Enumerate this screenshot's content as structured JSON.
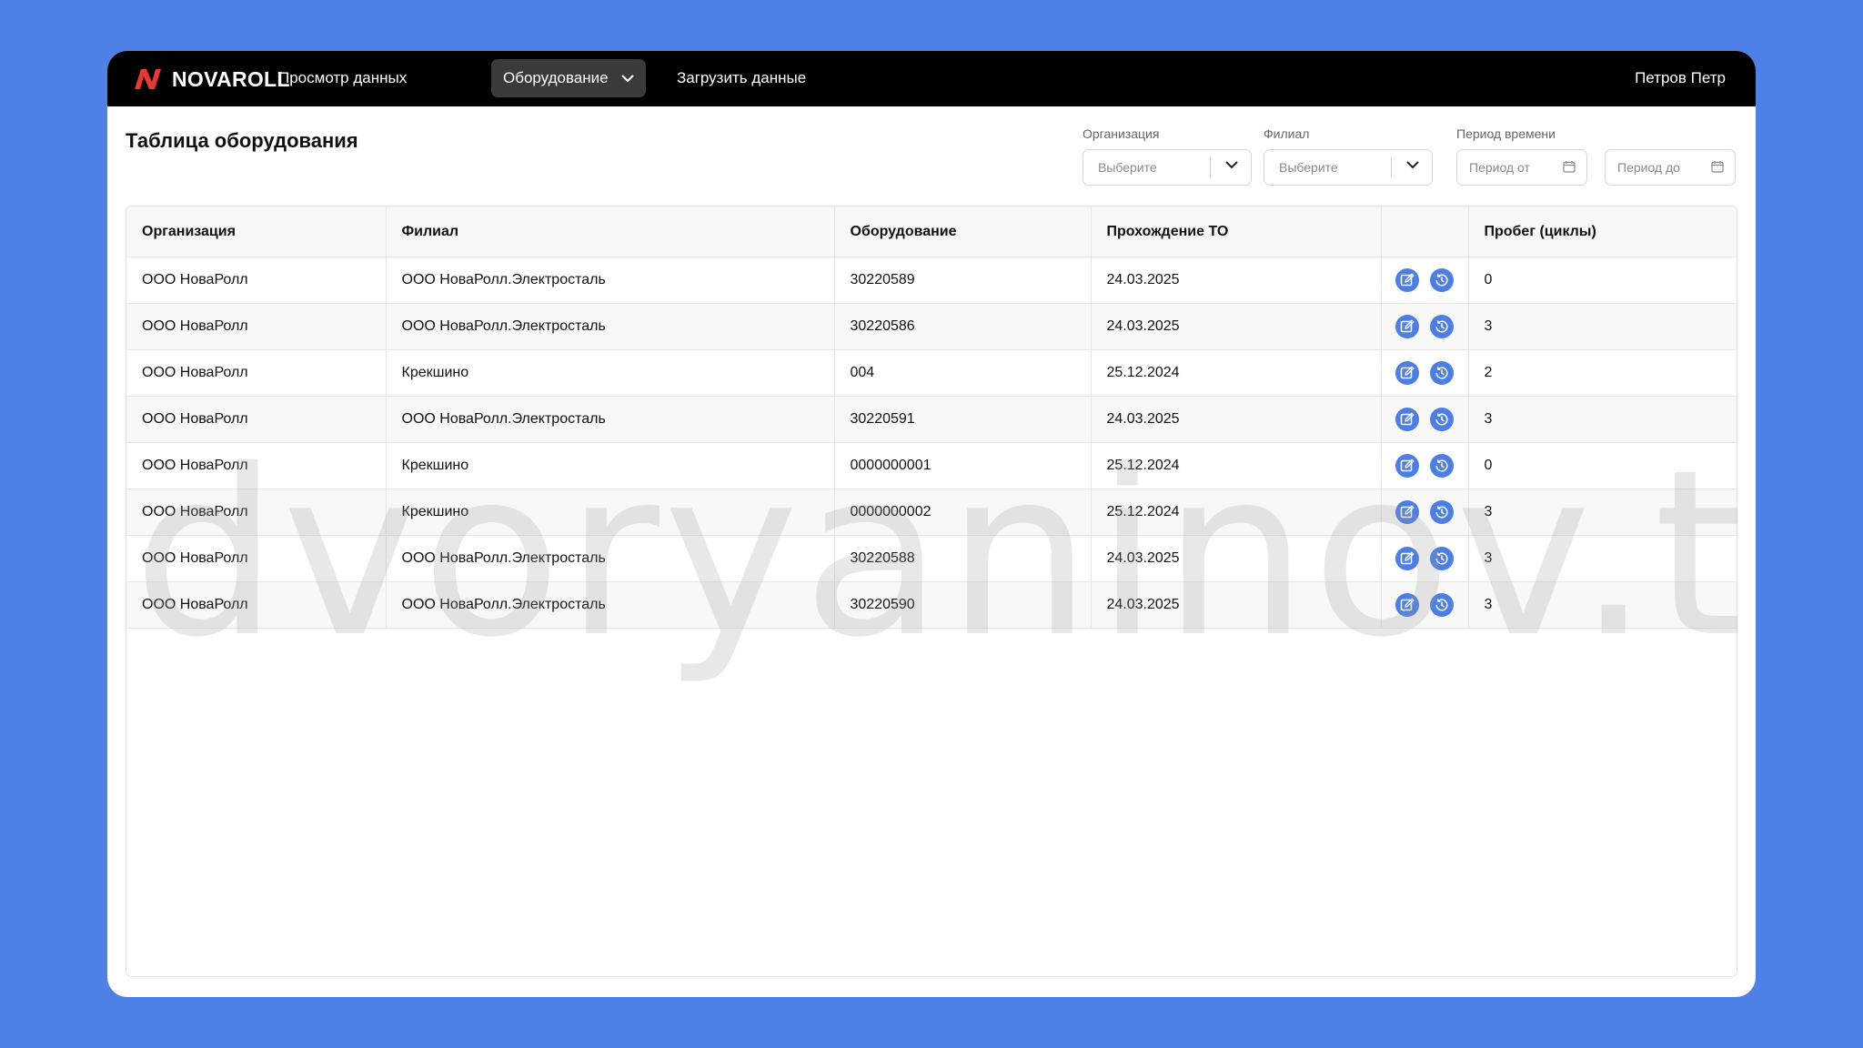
{
  "brand": {
    "name": "NOVAROLL",
    "logo_color": "#e53935"
  },
  "nav": {
    "items": [
      {
        "label": "Просмотр данных"
      },
      {
        "label": "Оборудование"
      },
      {
        "label": "Загрузить данные"
      }
    ],
    "active_index": 1,
    "user_name": "Петров Петр"
  },
  "page": {
    "title": "Таблица оборудования"
  },
  "filters": {
    "organization": {
      "label": "Организация",
      "placeholder": "Выберите"
    },
    "branch": {
      "label": "Филиал",
      "placeholder": "Выберите"
    },
    "period": {
      "label": "Период времени",
      "from_placeholder": "Период от",
      "to_placeholder": "Период до"
    }
  },
  "table": {
    "columns": [
      "Организация",
      "Филиал",
      "Оборудование",
      "Прохождение ТО",
      "",
      "Пробег (циклы)"
    ],
    "rows": [
      [
        "ООО НоваРолл",
        "ООО НоваРолл.Электросталь",
        "30220589",
        "24.03.2025",
        "0"
      ],
      [
        "ООО НоваРолл",
        "ООО НоваРолл.Электросталь",
        "30220586",
        "24.03.2025",
        "3"
      ],
      [
        "ООО НоваРолл",
        "Крекшино",
        "004",
        "25.12.2024",
        "2"
      ],
      [
        "ООО НоваРолл",
        "ООО НоваРолл.Электросталь",
        "30220591",
        "24.03.2025",
        "3"
      ],
      [
        "ООО НоваРолл",
        "Крекшино",
        "0000000001",
        "25.12.2024",
        "0"
      ],
      [
        "ООО НоваРолл",
        "Крекшино",
        "0000000002",
        "25.12.2024",
        "3"
      ],
      [
        "ООО НоваРолл",
        "ООО НоваРолл.Электросталь",
        "30220588",
        "24.03.2025",
        "3"
      ],
      [
        "ООО НоваРолл",
        "ООО НоваРолл.Электросталь",
        "30220590",
        "24.03.2025",
        "3"
      ]
    ],
    "row_actions": [
      "edit-icon",
      "history-icon"
    ]
  },
  "watermark": "dvoryaninov.tech",
  "colors": {
    "background": "#4f80e6",
    "accent": "#4d7fe3",
    "navbar": "#000000"
  }
}
